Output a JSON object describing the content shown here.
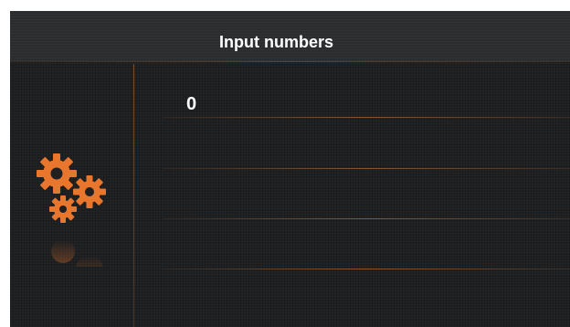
{
  "header": {
    "title": "Input numbers"
  },
  "input": {
    "value": "0"
  },
  "sidebar": {
    "icon": "gears-icon"
  },
  "colors": {
    "accent": "#e8762c",
    "background": "#1e2022",
    "text": "#ffffff"
  }
}
